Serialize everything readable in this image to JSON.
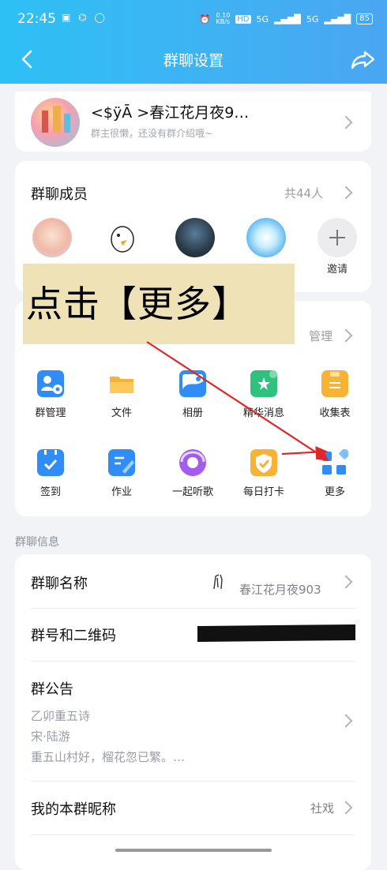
{
  "status_bar": {
    "time": "22:45",
    "left_icons": "▣ ⌬ ◯",
    "net_speed": "0.10\nKB/s",
    "hd": "HD",
    "sig1": "5G",
    "sig2": "5G",
    "battery": "85"
  },
  "header": {
    "title": "群聊设置"
  },
  "group": {
    "name": "<$ÿĀ      >春江花月夜9…",
    "intro": "群主很懒，还没有群介绍哦~"
  },
  "members": {
    "title": "群聊成员",
    "count": "共44人",
    "items": [
      {
        "label": ""
      },
      {
        "label": ""
      },
      {
        "label": ""
      },
      {
        "label": ""
      }
    ],
    "invite_label": "邀请"
  },
  "apps": {
    "manage_label": "管理",
    "items": [
      {
        "label": "群管理",
        "icon": "group-manage-icon",
        "color": "#2f8df5"
      },
      {
        "label": "文件",
        "icon": "folder-icon",
        "color": "#f6b335"
      },
      {
        "label": "相册",
        "icon": "album-icon",
        "color": "#2f8df5"
      },
      {
        "label": "精华消息",
        "icon": "essence-message-icon",
        "color": "#2ec27e"
      },
      {
        "label": "收集表",
        "icon": "clipboard-icon",
        "color": "#f6b335"
      },
      {
        "label": "签到",
        "icon": "calendar-checkin-icon",
        "color": "#2f8df5"
      },
      {
        "label": "作业",
        "icon": "homework-icon",
        "color": "#2f8df5"
      },
      {
        "label": "一起听歌",
        "icon": "music-together-icon",
        "color": "#a25cf0"
      },
      {
        "label": "每日打卡",
        "icon": "daily-checkin-icon",
        "color": "#f6b335"
      },
      {
        "label": "更多",
        "icon": "more-apps-icon",
        "color": "#2f8df5"
      }
    ]
  },
  "info": {
    "section_label": "群聊信息",
    "name_label": "群聊名称",
    "name_value": "春江花月夜903",
    "number_label": "群号和二维码",
    "notice_label": "群公告",
    "notice_lines": [
      "乙卯重五诗",
      "宋·陆游",
      "重五山村好，榴花忽已繁。…"
    ],
    "nickname_label": "我的本群昵称",
    "nickname_value": "社戏"
  },
  "overlay": {
    "text": "点击【更多】"
  }
}
